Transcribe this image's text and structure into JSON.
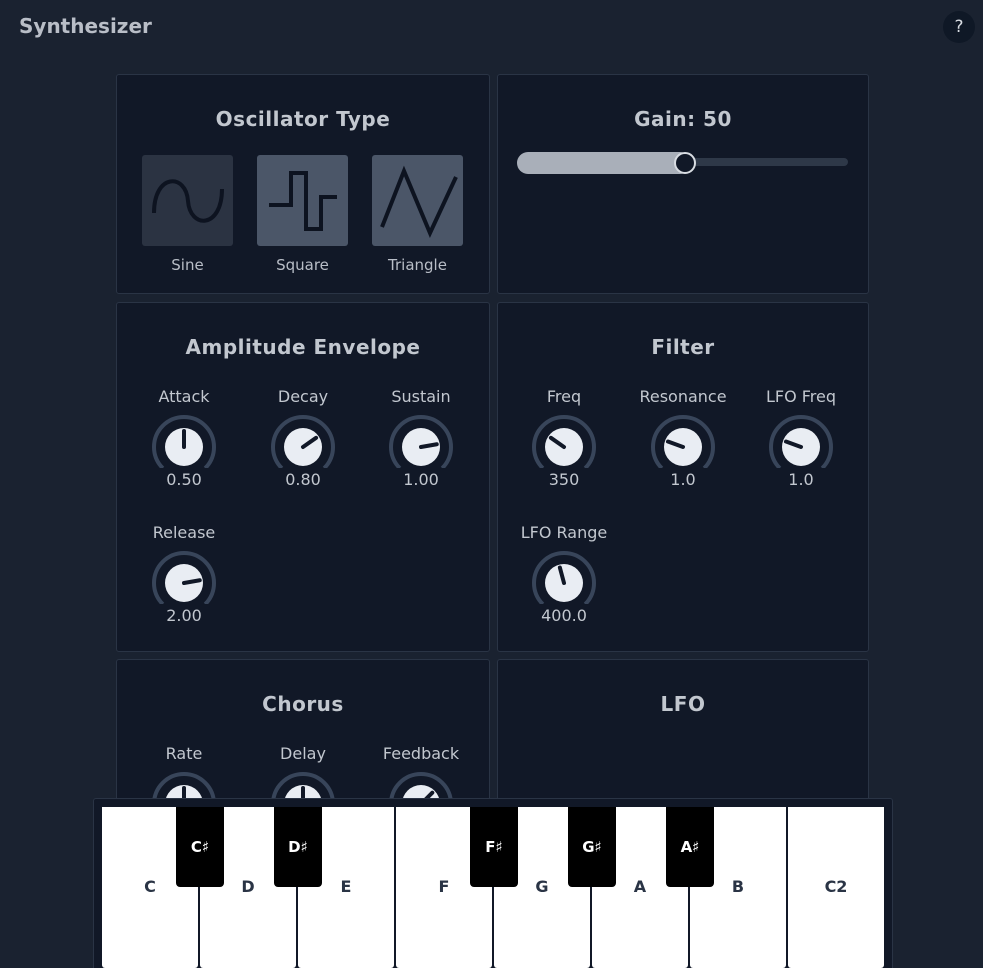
{
  "app": {
    "title": "Synthesizer",
    "help_label": "?"
  },
  "oscillator": {
    "title": "Oscillator Type",
    "types": [
      {
        "label": "Sine",
        "icon": "sine-wave-icon",
        "selected": false
      },
      {
        "label": "Square",
        "icon": "square-wave-icon",
        "selected": true
      },
      {
        "label": "Triangle",
        "icon": "triangle-wave-icon",
        "selected": true
      }
    ]
  },
  "gain": {
    "title": "Gain: 50",
    "value": 50,
    "min": 0,
    "max": 100
  },
  "envelope": {
    "title": "Amplitude Envelope",
    "knobs": [
      {
        "label": "Attack",
        "value": "0.50",
        "angle": 0
      },
      {
        "label": "Decay",
        "value": "0.80",
        "angle": 55
      },
      {
        "label": "Sustain",
        "value": "1.00",
        "angle": 80
      },
      {
        "label": "Release",
        "value": "2.00",
        "angle": 80
      }
    ]
  },
  "filter": {
    "title": "Filter",
    "knobs": [
      {
        "label": "Freq",
        "value": "350",
        "angle": -55
      },
      {
        "label": "Resonance",
        "value": "1.0",
        "angle": -70
      },
      {
        "label": "LFO Freq",
        "value": "1.0",
        "angle": -70
      },
      {
        "label": "LFO Range",
        "value": "400.0",
        "angle": -15
      }
    ]
  },
  "chorus": {
    "title": "Chorus",
    "knobs": [
      {
        "label": "Rate",
        "angle": 0
      },
      {
        "label": "Delay",
        "angle": 0
      },
      {
        "label": "Feedback",
        "angle": 45
      }
    ]
  },
  "lfo": {
    "title": "LFO"
  },
  "keyboard": {
    "white_keys": [
      "C",
      "D",
      "E",
      "F",
      "G",
      "A",
      "B",
      "C2"
    ],
    "black_keys": [
      "C♯",
      "D♯",
      "F♯",
      "G♯",
      "A♯"
    ]
  },
  "colors": {
    "background": "#1a2230",
    "panel": "#111827",
    "accent": "#a9afb9",
    "selected": "#4b5668"
  }
}
